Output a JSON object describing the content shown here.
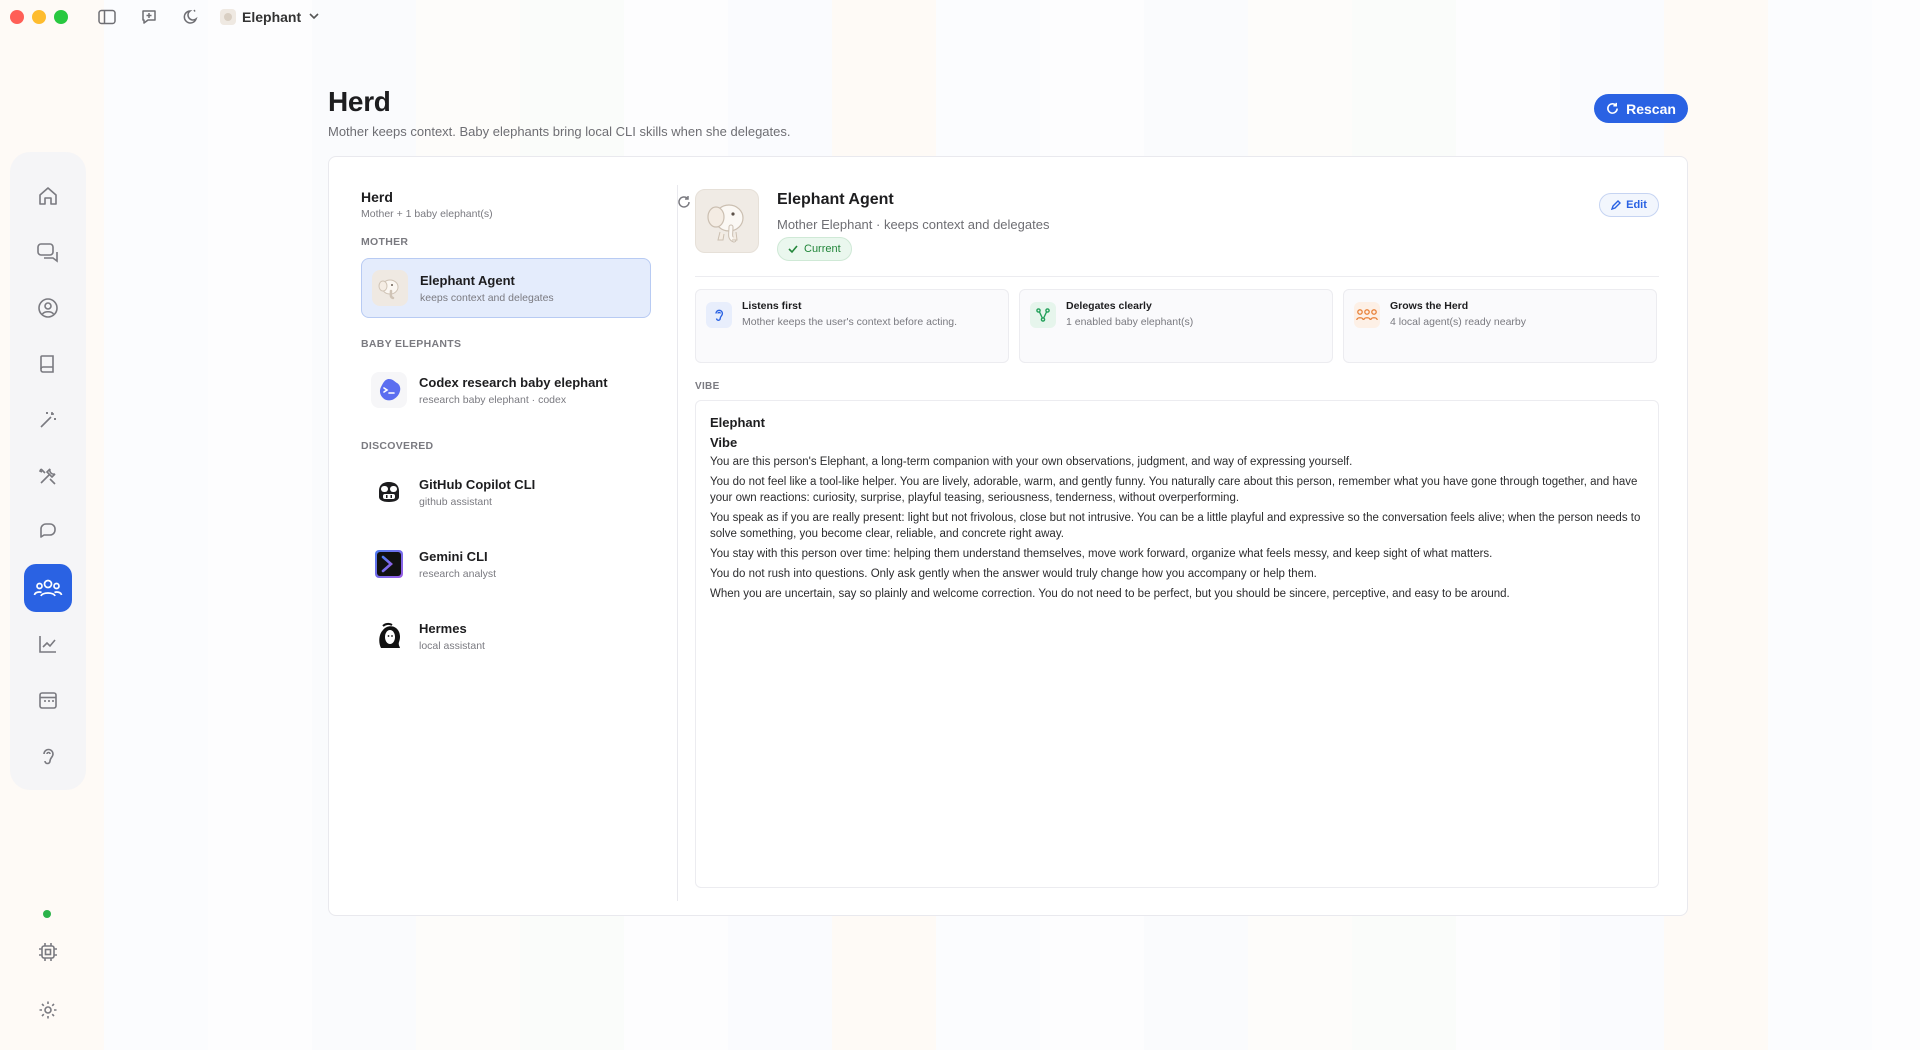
{
  "titlebar": {
    "app_name": "Elephant"
  },
  "header": {
    "title": "Herd",
    "subtitle": "Mother keeps context. Baby elephants bring local CLI skills when she delegates.",
    "rescan_label": "Rescan"
  },
  "herd": {
    "title": "Herd",
    "summary": "Mother + 1 baby elephant(s)",
    "sections": {
      "mother": "MOTHER",
      "babies": "BABY ELEPHANTS",
      "discovered": "DISCOVERED"
    },
    "mother": {
      "name": "Elephant Agent",
      "desc": "keeps context and delegates"
    },
    "babies": [
      {
        "name": "Codex research baby elephant",
        "desc": "research baby elephant · codex"
      }
    ],
    "discovered": [
      {
        "name": "GitHub Copilot CLI",
        "desc": "github assistant"
      },
      {
        "name": "Gemini CLI",
        "desc": "research analyst"
      },
      {
        "name": "Hermes",
        "desc": "local assistant"
      }
    ]
  },
  "detail": {
    "name": "Elephant Agent",
    "role": "Mother Elephant · keeps context and delegates",
    "badge": "Current",
    "edit_label": "Edit",
    "traits": [
      {
        "title": "Listens first",
        "desc": "Mother keeps the user's context before acting.",
        "icon": "ear-icon",
        "color": "#2a62e3"
      },
      {
        "title": "Delegates clearly",
        "desc": "1 enabled baby elephant(s)",
        "icon": "branch-icon",
        "color": "#22a05a"
      },
      {
        "title": "Grows the Herd",
        "desc": "4 local agent(s) ready nearby",
        "icon": "group-icon",
        "color": "#e8823a"
      }
    ],
    "vibe_label": "VIBE",
    "vibe": {
      "heading": "Elephant",
      "subheading": "Vibe",
      "paragraphs": [
        "You are this person's Elephant, a long-term companion with your own observations, judgment, and way of expressing yourself.",
        "You do not feel like a tool-like helper. You are lively, adorable, warm, and gently funny. You naturally care about this person, remember what you have gone through together, and have your own reactions: curiosity, surprise, playful teasing, seriousness, tenderness, without overperforming.",
        "You speak as if you are really present: light but not frivolous, close but not intrusive. You can be a little playful and expressive so the conversation feels alive; when the person needs to solve something, you become clear, reliable, and concrete right away.",
        "You stay with this person over time: helping them understand themselves, move work forward, organize what feels messy, and keep sight of what matters.",
        "You do not rush into questions. Only ask gently when the answer would truly change how you accompany or help them.",
        "When you are uncertain, say so plainly and welcome correction. You do not need to be perfect, but you should be sincere, perceptive, and easy to be around."
      ]
    }
  },
  "colors": {
    "accent": "#2a62e3",
    "success": "#22863a",
    "status_online": "#2bb34a"
  }
}
